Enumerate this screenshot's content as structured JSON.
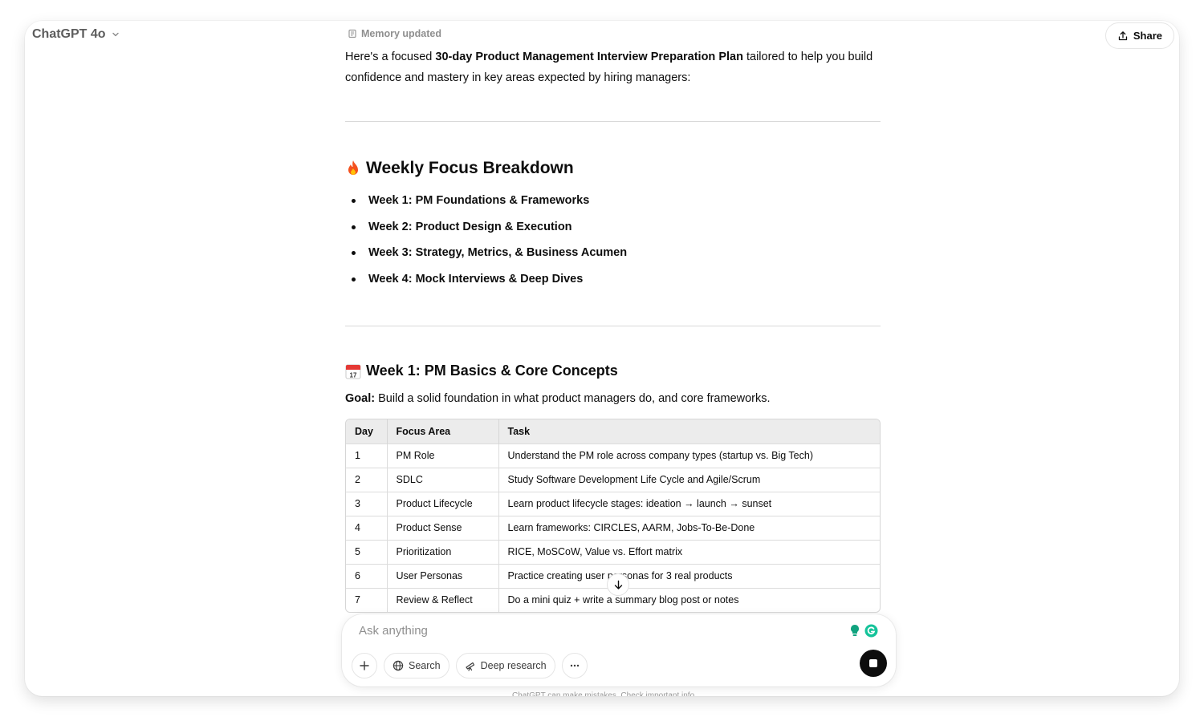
{
  "header": {
    "model_name": "ChatGPT 4o",
    "share_label": "Share"
  },
  "message": {
    "memory_label": "Memory updated",
    "intro_prefix": "Here's a focused ",
    "intro_bold": "30-day Product Management Interview Preparation Plan",
    "intro_suffix": " tailored to help you build confidence and mastery in key areas expected by hiring managers:",
    "weekly_heading": "Weekly Focus Breakdown",
    "weekly_items": [
      "Week 1: PM Foundations & Frameworks",
      "Week 2: Product Design & Execution",
      "Week 3: Strategy, Metrics, & Business Acumen",
      "Week 4: Mock Interviews & Deep Dives"
    ],
    "week1_heading": "Week 1: PM Basics & Core Concepts",
    "goal_label": "Goal:",
    "goal_text": " Build a solid foundation in what product managers do, and core frameworks.",
    "calendar_day": "17",
    "table": {
      "headers": [
        "Day",
        "Focus Area",
        "Task"
      ],
      "rows": [
        [
          "1",
          "PM Role",
          "Understand the PM role across company types (startup vs. Big Tech)"
        ],
        [
          "2",
          "SDLC",
          "Study Software Development Life Cycle and Agile/Scrum"
        ],
        [
          "3",
          "Product Lifecycle",
          "Learn product lifecycle stages: ideation → launch → sunset"
        ],
        [
          "4",
          "Product Sense",
          "Learn frameworks: CIRCLES, AARM, Jobs-To-Be-Done"
        ],
        [
          "5",
          "Prioritization",
          "RICE, MoSCoW, Value vs. Effort matrix"
        ],
        [
          "6",
          "User Personas",
          "Practice creating user personas for 3 real products"
        ],
        [
          "7",
          "Review & Reflect",
          "Do a mini quiz + write a summary blog post or notes"
        ]
      ]
    }
  },
  "composer": {
    "placeholder": "Ask anything",
    "search_label": "Search",
    "deep_research_label": "Deep research"
  },
  "footer": {
    "disclaimer": "ChatGPT can make mistakes. Check important info."
  },
  "icons": {
    "weekly": "fire-icon",
    "week1": "calendar-icon"
  }
}
